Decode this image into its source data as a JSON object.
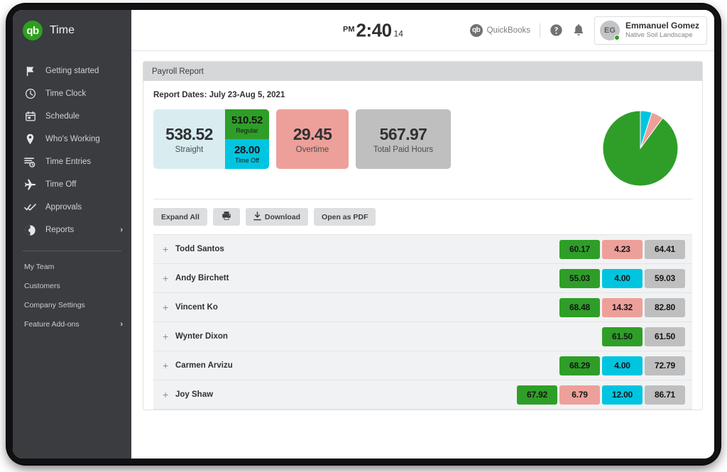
{
  "app": {
    "brand_name": "Time",
    "logo_text": "qb"
  },
  "sidebar": {
    "items": [
      {
        "label": "Getting started",
        "icon": "flag-icon",
        "chevron": ""
      },
      {
        "label": "Time Clock",
        "icon": "clock-icon",
        "chevron": ""
      },
      {
        "label": "Schedule",
        "icon": "calendar-icon",
        "chevron": ""
      },
      {
        "label": "Who's Working",
        "icon": "map-pin-icon",
        "chevron": ""
      },
      {
        "label": "Time Entries",
        "icon": "time-entries-icon",
        "chevron": ""
      },
      {
        "label": "Time Off",
        "icon": "airplane-icon",
        "chevron": ""
      },
      {
        "label": "Approvals",
        "icon": "double-check-icon",
        "chevron": ""
      },
      {
        "label": "Reports",
        "icon": "pie-chart-icon",
        "chevron": "›"
      }
    ],
    "sub_items": [
      {
        "label": "My Team",
        "chevron": ""
      },
      {
        "label": "Customers",
        "chevron": ""
      },
      {
        "label": "Company Settings",
        "chevron": ""
      },
      {
        "label": "Feature Add-ons",
        "chevron": "›"
      }
    ]
  },
  "header": {
    "clock": {
      "ampm": "PM",
      "time": "2:40",
      "seconds": "14"
    },
    "quickbooks_label": "QuickBooks",
    "quickbooks_logo_text": "qb",
    "help_icon": "help-circle-icon",
    "notifications_icon": "bell-icon",
    "user": {
      "initials": "EG",
      "name": "Emmanuel Gomez",
      "organization": "Native Soil Landscape"
    }
  },
  "report": {
    "title": "Payroll Report",
    "dates_label": "Report Dates: July 23-Aug 5, 2021",
    "summary": {
      "straight": {
        "value": "538.52",
        "label": "Straight"
      },
      "regular": {
        "value": "510.52",
        "label": "Regular"
      },
      "time_off": {
        "value": "28.00",
        "label": "Time Off"
      },
      "overtime": {
        "value": "29.45",
        "label": "Overtime"
      },
      "total": {
        "value": "567.97",
        "label": "Total Paid Hours"
      }
    },
    "toolbar": {
      "expand_all": "Expand All",
      "print": "",
      "print_icon": "printer-icon",
      "download": "Download",
      "download_icon": "download-icon",
      "open_as_pdf": "Open as PDF"
    },
    "rows": [
      {
        "name": "Todd Santos",
        "expand": "+",
        "badges": [
          {
            "value": "60.17",
            "color": "green"
          },
          {
            "value": "4.23",
            "color": "pink"
          },
          {
            "value": "64.41",
            "color": "gray"
          }
        ]
      },
      {
        "name": "Andy Birchett",
        "expand": "+",
        "badges": [
          {
            "value": "55.03",
            "color": "green"
          },
          {
            "value": "4.00",
            "color": "cyan"
          },
          {
            "value": "59.03",
            "color": "gray"
          }
        ]
      },
      {
        "name": "Vincent Ko",
        "expand": "+",
        "badges": [
          {
            "value": "68.48",
            "color": "green"
          },
          {
            "value": "14.32",
            "color": "pink"
          },
          {
            "value": "82.80",
            "color": "gray"
          }
        ]
      },
      {
        "name": "Wynter Dixon",
        "expand": "+",
        "badges": [
          {
            "value": "61.50",
            "color": "green"
          },
          {
            "value": "61.50",
            "color": "gray"
          }
        ]
      },
      {
        "name": "Carmen Arvizu",
        "expand": "+",
        "badges": [
          {
            "value": "68.29",
            "color": "green"
          },
          {
            "value": "4.00",
            "color": "cyan"
          },
          {
            "value": "72.79",
            "color": "gray"
          }
        ]
      },
      {
        "name": "Joy Shaw",
        "expand": "+",
        "badges": [
          {
            "value": "67.92",
            "color": "green"
          },
          {
            "value": "6.79",
            "color": "pink"
          },
          {
            "value": "12.00",
            "color": "cyan"
          },
          {
            "value": "86.71",
            "color": "gray"
          }
        ]
      }
    ]
  },
  "chart_data": {
    "type": "pie",
    "title": "",
    "labels": [
      "Regular",
      "Overtime",
      "Time Off"
    ],
    "values": [
      510.52,
      29.45,
      28.0
    ],
    "colors": [
      "#2f9e28",
      "#eda09a",
      "#00c5e0"
    ],
    "total": 567.97,
    "legend": "none",
    "start_angle_deg": 0
  },
  "colors": {
    "brand_green": "#2ca01c",
    "chart_green": "#2f9e28",
    "chart_pink": "#eda09a",
    "chart_cyan": "#00c5e0",
    "chart_gray": "#bfbfbf",
    "sidebar_bg": "#3a3c3f",
    "straight_bg": "#d9edf0"
  }
}
